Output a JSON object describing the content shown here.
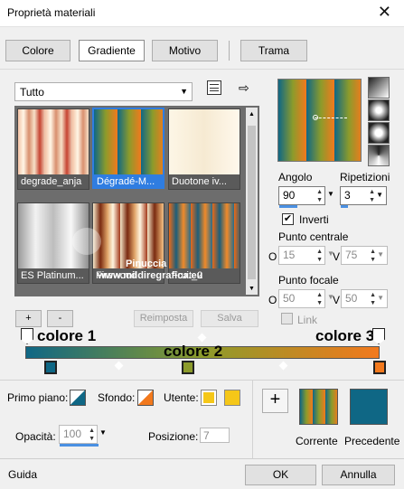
{
  "window": {
    "title": "Proprietà materiali",
    "close": "✕"
  },
  "tabs": [
    {
      "label": "Colore"
    },
    {
      "label": "Gradiente"
    },
    {
      "label": "Motivo"
    },
    {
      "label": "Trama"
    }
  ],
  "category": {
    "value": "Tutto"
  },
  "gradients": [
    {
      "label": "degrade_anja"
    },
    {
      "label": "Dégradé-M..."
    },
    {
      "label": "Duotone iv..."
    },
    {
      "label": "ES Platinum..."
    },
    {
      "label": "Firewood"
    },
    {
      "label": "Fruit_2"
    }
  ],
  "watermark": {
    "name": "Pinuccia",
    "site": "www.mildiregrafica.eu"
  },
  "buttons": {
    "add": "+",
    "remove": "-",
    "reset": "Reimposta",
    "save": "Salva"
  },
  "angle": {
    "label": "Angolo",
    "value": "90"
  },
  "repeats": {
    "label": "Ripetizioni",
    "value": "3"
  },
  "invert": {
    "label": "Inverti",
    "checked": true
  },
  "center": {
    "label": "Punto centrale",
    "h": "O",
    "h_value": "15",
    "v": "V",
    "v_value": "75"
  },
  "focal": {
    "label": "Punto focale",
    "h": "O",
    "h_value": "50",
    "v": "V",
    "v_value": "50"
  },
  "link": {
    "label": "Link"
  },
  "annotations": {
    "c1": "colore 1",
    "c2": "colore 2",
    "c3": "colore 3"
  },
  "colors": {
    "teal": "#0f6785",
    "olive": "#8c9b2b",
    "orange": "#f2791d",
    "yellow": "#f5c718",
    "accent": "#2f7de1"
  },
  "bottom": {
    "foreground": "Primo piano:",
    "background": "Sfondo:",
    "user": "Utente:",
    "opacity_label": "Opacità:",
    "opacity_value": "100",
    "position_label": "Posizione:",
    "position_value": "7",
    "current": "Corrente",
    "previous": "Precedente",
    "plus": "+"
  },
  "footer": {
    "help": "Guida",
    "ok": "OK",
    "cancel": "Annulla"
  }
}
